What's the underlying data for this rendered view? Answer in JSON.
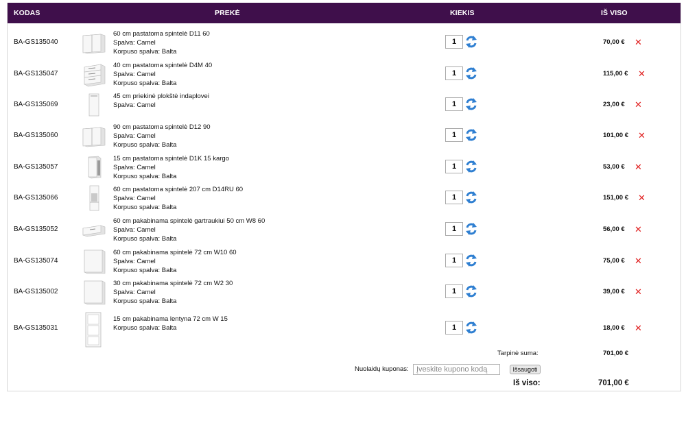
{
  "table": {
    "headers": {
      "code": "KODAS",
      "product": "PREKĖ",
      "quantity": "KIEKIS",
      "total": "IŠ VISO"
    }
  },
  "items": [
    {
      "code": "BA-GS135040",
      "name": "60 cm pastatoma spintelė D11 60",
      "color": "Spalva: Camel",
      "body_color": "Korpuso spalva: Balta",
      "qty": "1",
      "price": "70,00 €",
      "thumb": "base-cabinet-icon"
    },
    {
      "code": "BA-GS135047",
      "name": "40 cm pastatoma spintelė D4M 40",
      "color": "Spalva: Camel",
      "body_color": "Korpuso spalva: Balta",
      "qty": "1",
      "price": "115,00 €",
      "thumb": "drawer-cabinet-icon"
    },
    {
      "code": "BA-GS135069",
      "name": "45 cm priekinė plokštė indaplovei",
      "color": "Spalva: Camel",
      "body_color": "",
      "qty": "1",
      "price": "23,00 €",
      "thumb": "front-panel-icon"
    },
    {
      "code": "BA-GS135060",
      "name": "90 cm pastatoma spintelė D12 90",
      "color": "Spalva: Camel",
      "body_color": "Korpuso spalva: Balta",
      "qty": "1",
      "price": "101,00 €",
      "thumb": "base-cabinet-icon"
    },
    {
      "code": "BA-GS135057",
      "name": "15 cm pastatoma spintelė D1K 15 kargo",
      "color": "Spalva: Camel",
      "body_color": "Korpuso spalva: Balta",
      "qty": "1",
      "price": "53,00 €",
      "thumb": "cargo-cabinet-icon"
    },
    {
      "code": "BA-GS135066",
      "name": "60 cm pastatoma spintelė 207 cm D14RU 60",
      "color": "Spalva: Camel",
      "body_color": "Korpuso spalva: Balta",
      "qty": "1",
      "price": "151,00 €",
      "thumb": "tall-cabinet-icon"
    },
    {
      "code": "BA-GS135052",
      "name": "60 cm pakabinama spintelė gartraukiui 50 cm W8 60",
      "color": "Spalva: Camel",
      "body_color": "Korpuso spalva: Balta",
      "qty": "1",
      "price": "56,00 €",
      "thumb": "hood-cabinet-icon"
    },
    {
      "code": "BA-GS135074",
      "name": "60 cm pakabinama spintelė 72 cm W10 60",
      "color": "Spalva: Camel",
      "body_color": "Korpuso spalva: Balta",
      "qty": "1",
      "price": "75,00 €",
      "thumb": "wall-cabinet-icon"
    },
    {
      "code": "BA-GS135002",
      "name": "30 cm pakabinama spintelė 72 cm W2 30",
      "color": "Spalva: Camel",
      "body_color": "Korpuso spalva: Balta",
      "qty": "1",
      "price": "39,00 €",
      "thumb": "wall-cabinet-icon"
    },
    {
      "code": "BA-GS135031",
      "name": "15 cm pakabinama lentyna 72 cm W 15",
      "color": "Korpuso spalva: Balta",
      "body_color": "",
      "qty": "1",
      "price": "18,00 €",
      "thumb": "open-shelf-icon"
    }
  ],
  "summary": {
    "subtotal_label": "Tarpinė suma:",
    "subtotal_value": "701,00 €",
    "coupon_label": "Nuolaidų kuponas:",
    "coupon_placeholder": "Įveskite kupono kodą",
    "coupon_value": "",
    "save_label": "Išsaugoti",
    "total_label": "Iš viso:",
    "total_value": "701,00 €"
  },
  "colors": {
    "header_bg": "#3f0f4b",
    "header_text": "#ffffff",
    "delete": "#e02020",
    "refresh": "#2f7fd1"
  },
  "icons": {
    "refresh": "refresh-icon",
    "delete": "delete-icon"
  }
}
